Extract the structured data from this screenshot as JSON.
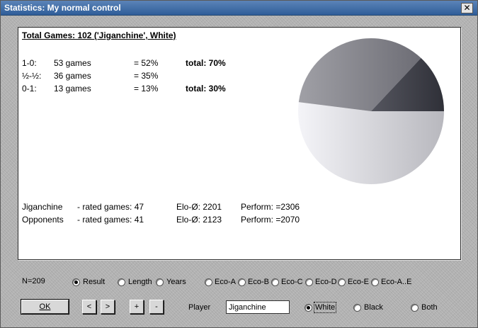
{
  "window": {
    "title": "Statistics: My normal control",
    "close_glyph": "✕"
  },
  "stats": {
    "heading": "Total Games: 102 ('Jiganchine', White)",
    "rows": [
      {
        "result": "1-0:",
        "games": "53 games",
        "pct": "= 52%",
        "total": "total: 70%"
      },
      {
        "result": "½-½:",
        "games": "36 games",
        "pct": "= 35%",
        "total": ""
      },
      {
        "result": "0-1:",
        "games": "13 games",
        "pct": "= 13%",
        "total": "total: 30%"
      }
    ],
    "players": [
      {
        "name": "Jiganchine",
        "rated": "- rated games: 47",
        "elo": "Elo-Ø: 2201",
        "perform": "Perform: =2306"
      },
      {
        "name": "Opponents",
        "rated": "- rated games: 41",
        "elo": "Elo-Ø: 2123",
        "perform": "Perform: =2070"
      }
    ]
  },
  "chart_data": {
    "type": "pie",
    "values": [
      52,
      35,
      13
    ],
    "colors": [
      "#e9e9ee",
      "#77777f",
      "#3f4049"
    ]
  },
  "controls": {
    "n_label": "N=209",
    "options": [
      {
        "label": "Result",
        "checked": true
      },
      {
        "label": "Length",
        "checked": false
      },
      {
        "label": "Years",
        "checked": false
      },
      {
        "label": "Eco-A",
        "checked": false
      },
      {
        "label": "Eco-B",
        "checked": false
      },
      {
        "label": "Eco-C",
        "checked": false
      },
      {
        "label": "Eco-D",
        "checked": false
      },
      {
        "label": "Eco-E",
        "checked": false
      },
      {
        "label": "Eco-A..E",
        "checked": false
      }
    ],
    "ok_label": "OK",
    "prev_label": "<",
    "next_label": ">",
    "plus_label": "+",
    "minus_label": "-",
    "player_label": "Player",
    "player_value": "Jiganchine",
    "colors": [
      {
        "label": "White",
        "checked": true
      },
      {
        "label": "Black",
        "checked": false
      },
      {
        "label": "Both",
        "checked": false
      }
    ]
  }
}
